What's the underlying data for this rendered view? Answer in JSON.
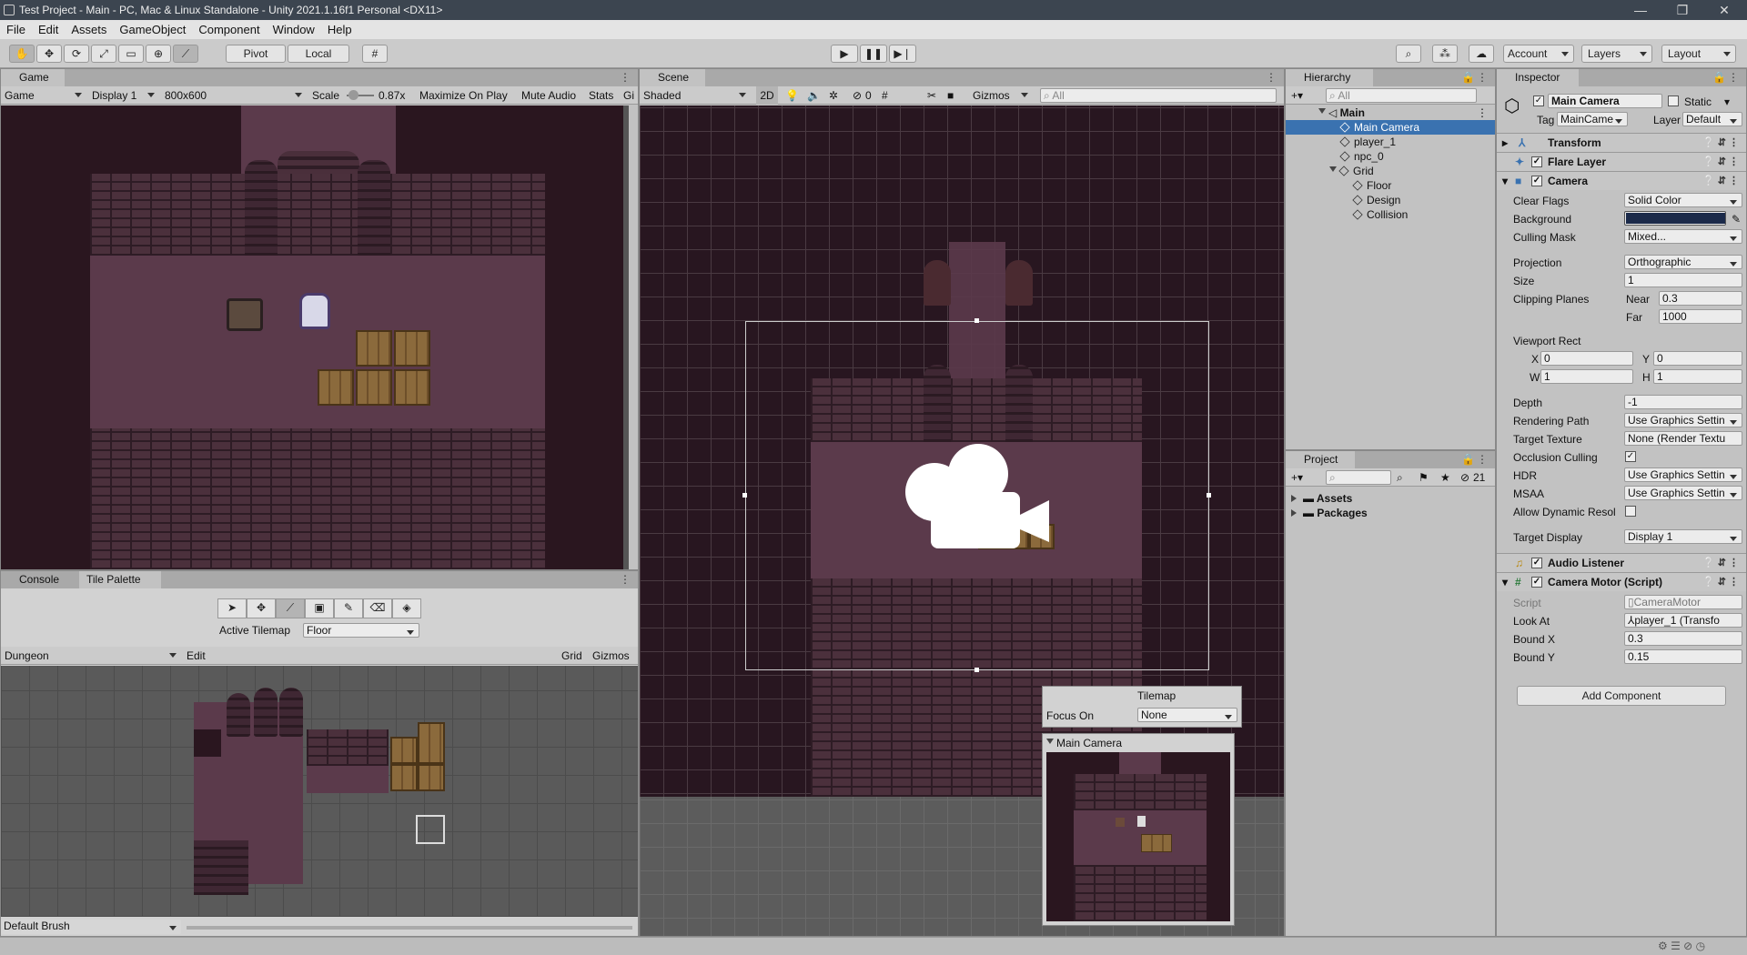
{
  "app": {
    "title": "Test Project - Main - PC, Mac & Linux Standalone - Unity 2021.1.16f1 Personal <DX11>"
  },
  "menu": [
    "File",
    "Edit",
    "Assets",
    "GameObject",
    "Component",
    "Window",
    "Help"
  ],
  "toolbar": {
    "pivot": "Pivot",
    "local": "Local",
    "account": "Account",
    "layers": "Layers",
    "layout": "Layout"
  },
  "game": {
    "tab": "Game",
    "mode": "Game",
    "display": "Display 1",
    "resolution": "800x600",
    "scale_label": "Scale",
    "scale_value": "0.87x",
    "maximize": "Maximize On Play",
    "mute": "Mute Audio",
    "stats": "Stats",
    "gizmos_short": "Gi"
  },
  "scene": {
    "tab": "Scene",
    "shading": "Shaded",
    "mode_2d": "2D",
    "hidden_count": "0",
    "gizmos": "Gizmos",
    "search_placeholder": "All"
  },
  "tilemap_overlay": {
    "title": "Tilemap",
    "focus_label": "Focus On",
    "focus_value": "None"
  },
  "camera_preview": {
    "title": "Main Camera"
  },
  "console": {
    "tab_console": "Console",
    "tab_palette": "Tile Palette",
    "active_tilemap_label": "Active Tilemap",
    "active_tilemap_value": "Floor",
    "palette": "Dungeon",
    "edit": "Edit",
    "grid": "Grid",
    "gizmos": "Gizmos",
    "brush": "Default Brush"
  },
  "hierarchy": {
    "tab": "Hierarchy",
    "search_placeholder": "All",
    "items": [
      {
        "label": "Main",
        "depth": 0,
        "kind": "scene"
      },
      {
        "label": "Main Camera",
        "depth": 2,
        "kind": "object",
        "selected": true
      },
      {
        "label": "player_1",
        "depth": 2,
        "kind": "object"
      },
      {
        "label": "npc_0",
        "depth": 2,
        "kind": "object"
      },
      {
        "label": "Grid",
        "depth": 1,
        "kind": "parent"
      },
      {
        "label": "Floor",
        "depth": 3,
        "kind": "object"
      },
      {
        "label": "Design",
        "depth": 3,
        "kind": "object"
      },
      {
        "label": "Collision",
        "depth": 3,
        "kind": "object"
      }
    ]
  },
  "project": {
    "tab": "Project",
    "count": "21",
    "folders": [
      "Assets",
      "Packages"
    ]
  },
  "inspector": {
    "tab": "Inspector",
    "object_name": "Main Camera",
    "static": "Static",
    "tag_label": "Tag",
    "tag_value": "MainCame",
    "layer_label": "Layer",
    "layer_value": "Default",
    "components": {
      "transform": "Transform",
      "flare": "Flare Layer",
      "camera": "Camera",
      "audio": "Audio Listener",
      "motor": "Camera Motor (Script)"
    },
    "camera": {
      "clear_flags_label": "Clear Flags",
      "clear_flags": "Solid Color",
      "background_label": "Background",
      "background_color": "#1b2a4a",
      "culling_label": "Culling Mask",
      "culling": "Mixed...",
      "projection_label": "Projection",
      "projection": "Orthographic",
      "size_label": "Size",
      "size": "1",
      "clipping_label": "Clipping Planes",
      "near_label": "Near",
      "near": "0.3",
      "far_label": "Far",
      "far": "1000",
      "viewport_label": "Viewport Rect",
      "x_label": "X",
      "x": "0",
      "y_label": "Y",
      "y": "0",
      "w_label": "W",
      "w": "1",
      "h_label": "H",
      "h": "1",
      "depth_label": "Depth",
      "depth": "-1",
      "rpath_label": "Rendering Path",
      "rpath": "Use Graphics Settin",
      "ttex_label": "Target Texture",
      "ttex": "None (Render Textu",
      "occ_label": "Occlusion Culling",
      "hdr_label": "HDR",
      "hdr": "Use Graphics Settin",
      "msaa_label": "MSAA",
      "msaa": "Use Graphics Settin",
      "adr_label": "Allow Dynamic Resol",
      "tdisp_label": "Target Display",
      "tdisp": "Display 1"
    },
    "motor": {
      "script_label": "Script",
      "script": "CameraMotor",
      "lookat_label": "Look At",
      "lookat": "player_1 (Transfo",
      "bx_label": "Bound X",
      "bx": "0.3",
      "by_label": "Bound Y",
      "by": "0.15"
    },
    "add_component": "Add Component"
  }
}
